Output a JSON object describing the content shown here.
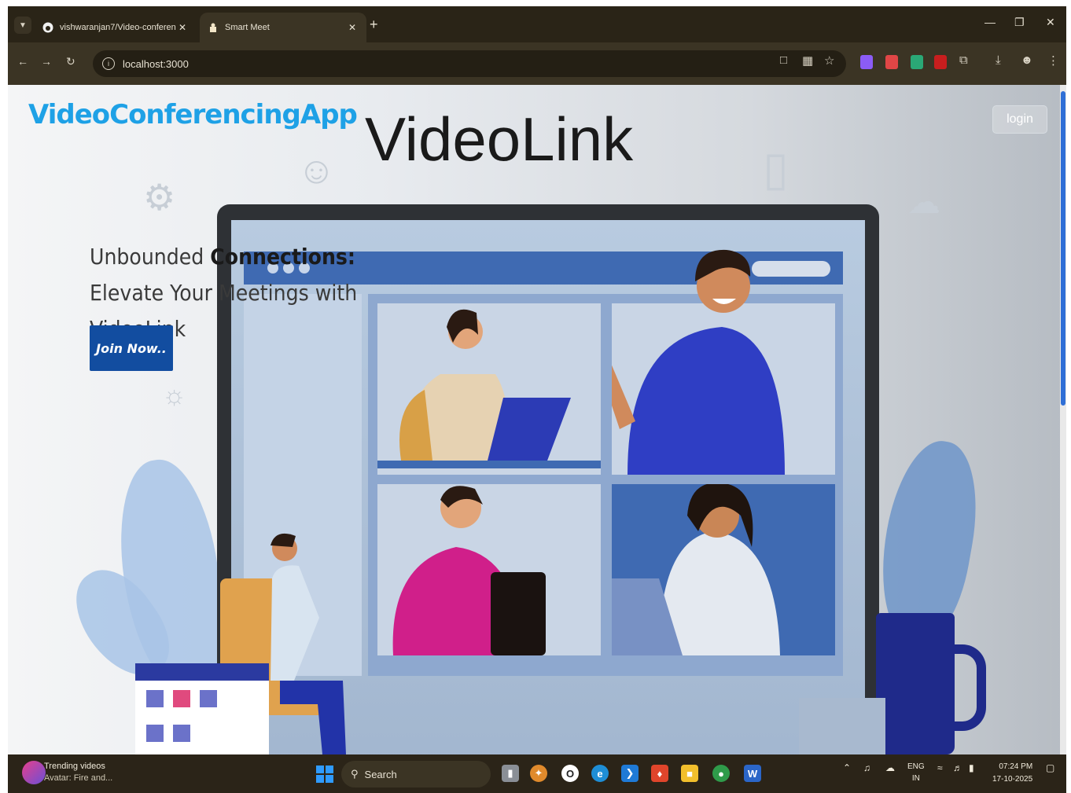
{
  "browser": {
    "tabs": [
      {
        "title": "vishwaranjan7/Video-conferen",
        "favicon": "github-icon",
        "active": false
      },
      {
        "title": "Smart Meet",
        "favicon": "smart-meet-icon",
        "active": true
      }
    ],
    "new_tab": "+",
    "address": "localhost:3000"
  },
  "page": {
    "brand": "VideoConferencingApp",
    "title": "VideoLink",
    "login_label": "login",
    "tagline": {
      "prefix": "Unbounded ",
      "bold": "Connections:",
      "suffix": " Elevate Your Meetings with VideoLink"
    },
    "join_label": "Join Now.."
  },
  "taskbar": {
    "widget_title": "Trending videos",
    "widget_sub": "Avatar: Fire and...",
    "search_label": "Search",
    "lang_top": "ENG",
    "lang_bottom": "IN",
    "time": "07:24 PM",
    "date": "17-10-2025"
  },
  "colors": {
    "brand": "#1ea1e6",
    "join_button": "#124da0",
    "chrome": "#2b2418"
  }
}
